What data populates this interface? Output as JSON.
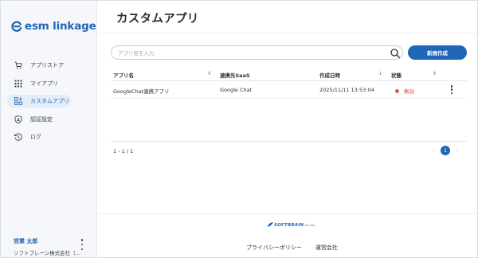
{
  "app": {
    "logo_text": "esm linkage"
  },
  "sidebar": {
    "items": [
      {
        "label": "アプリストア",
        "icon": "cart-icon",
        "active": false
      },
      {
        "label": "マイアプリ",
        "icon": "grid-icon",
        "active": false
      },
      {
        "label": "カスタムアプリ",
        "icon": "blocks-icon",
        "active": true
      },
      {
        "label": "認証設定",
        "icon": "shield-icon",
        "active": false
      },
      {
        "label": "ログ",
        "icon": "history-icon",
        "active": false
      }
    ],
    "user": {
      "name": "営業 太郎",
      "org": "ソフトブレーン株式会社（..."
    }
  },
  "main": {
    "title": "カスタムアプリ",
    "search": {
      "placeholder": "アプリ名を入力",
      "value": ""
    },
    "new_button_label": "新規作成",
    "table": {
      "headers": [
        "アプリ名",
        "連携先SaaS",
        "作成日時",
        "状態"
      ],
      "rows": [
        {
          "name": "GoogleChat連携アプリ",
          "saas": "Google Chat",
          "created_at": "2025/11/11 13:53:04",
          "status": "無効"
        }
      ]
    },
    "pagination": {
      "range": "1 - 1 / 1",
      "current_page": "1",
      "prev": "‹",
      "next": "›"
    }
  },
  "footer": {
    "brand": "SOFTBRAIN",
    "brand_suffix": "Co.,Ltd.",
    "links": [
      "プライバシーポリシー",
      "運営会社"
    ]
  },
  "colors": {
    "accent": "#1f66b7",
    "status_inactive": "#e05353",
    "sidebar_bg": "#f5f7fa"
  }
}
